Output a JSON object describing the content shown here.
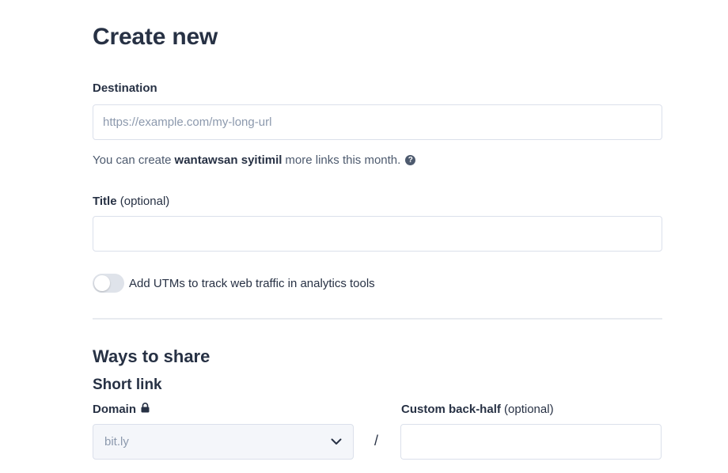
{
  "page": {
    "title": "Create new"
  },
  "destination": {
    "label": "Destination",
    "placeholder": "https://example.com/my-long-url",
    "value": ""
  },
  "quota": {
    "prefix": "You can create",
    "count": "wantawsan syitimil",
    "suffix": "more links this month.",
    "help_icon": "?"
  },
  "title_field": {
    "label": "Title",
    "optional": "(optional)",
    "value": ""
  },
  "utm_toggle": {
    "label": "Add UTMs to track web traffic in analytics tools",
    "enabled": false
  },
  "share": {
    "section_title": "Ways to share",
    "short_link_title": "Short link",
    "domain": {
      "label": "Domain",
      "icon": "lock-icon",
      "selected": "bit.ly"
    },
    "separator": "/",
    "back_half": {
      "label": "Custom back-half",
      "optional": "(optional)",
      "value": ""
    }
  },
  "colors": {
    "text": "#273144",
    "muted": "#8c99ad",
    "border": "#dbe0eb",
    "toggle_off": "#dfe3ea"
  }
}
